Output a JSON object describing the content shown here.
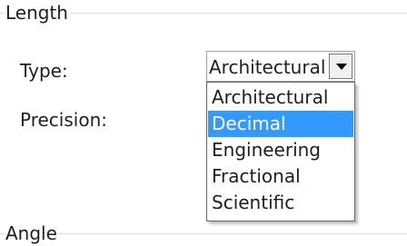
{
  "length_section": {
    "title": "Length",
    "type_label": "Type:",
    "precision_label": "Precision:",
    "type_dropdown": {
      "selected_value": "Architectural",
      "options": [
        "Architectural",
        "Decimal",
        "Engineering",
        "Fractional",
        "Scientific"
      ],
      "highlighted_option": "Decimal"
    }
  },
  "angle_section": {
    "title": "Angle"
  },
  "colors": {
    "highlight": "#3399ff",
    "highlight_text": "#ffffff"
  }
}
